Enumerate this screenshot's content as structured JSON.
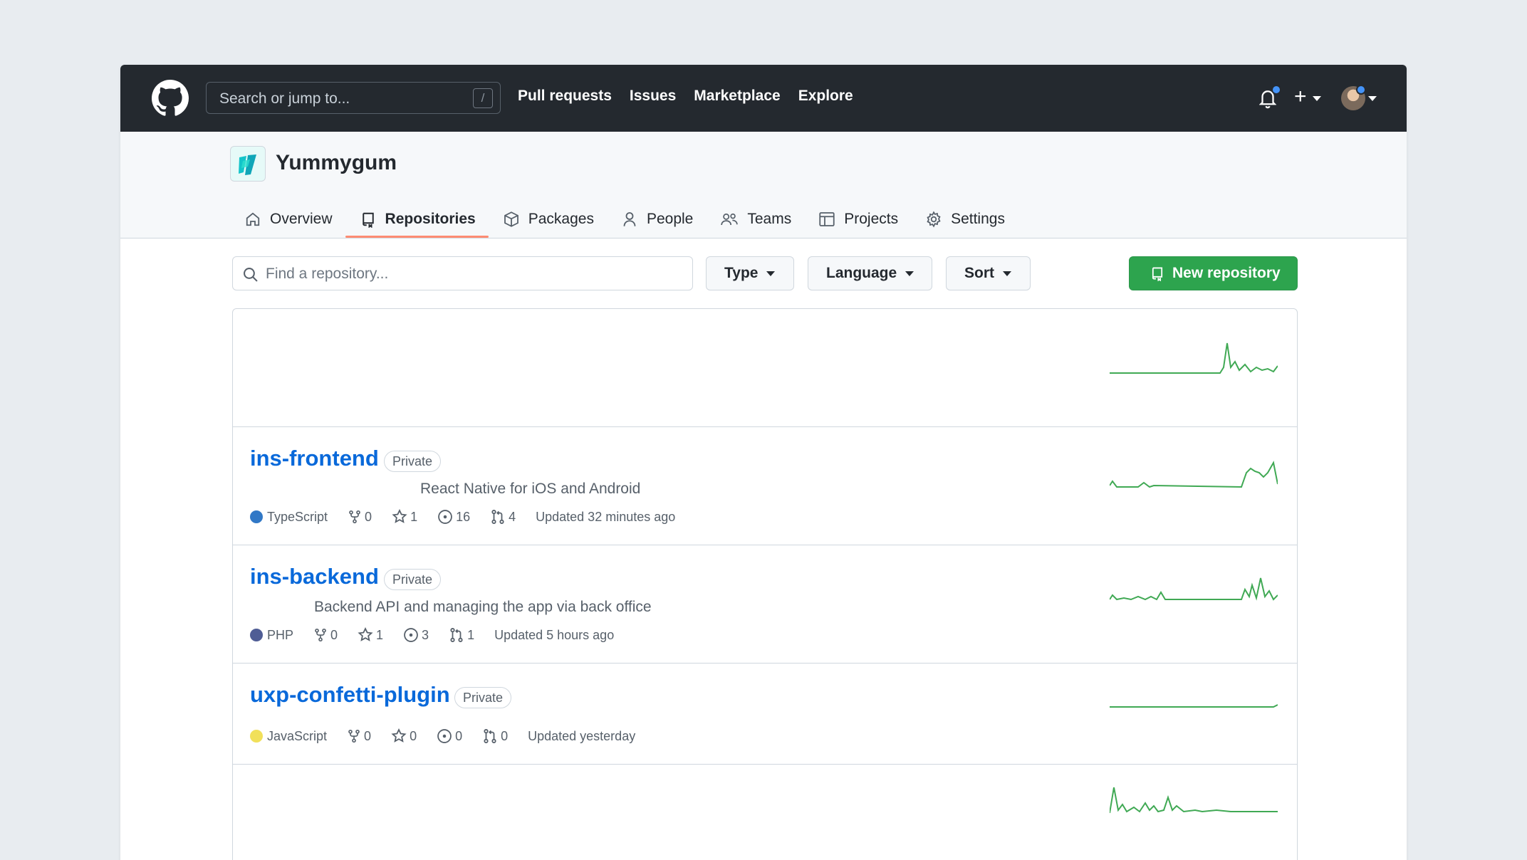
{
  "topbar": {
    "search_placeholder": "Search or jump to...",
    "slash_key": "/",
    "nav": [
      "Pull requests",
      "Issues",
      "Marketplace",
      "Explore"
    ]
  },
  "org": {
    "name": "Yummygum",
    "tabs": [
      {
        "label": "Overview",
        "icon": "home-icon"
      },
      {
        "label": "Repositories",
        "icon": "repo-icon",
        "active": true
      },
      {
        "label": "Packages",
        "icon": "package-icon"
      },
      {
        "label": "People",
        "icon": "person-icon"
      },
      {
        "label": "Teams",
        "icon": "people-icon"
      },
      {
        "label": "Projects",
        "icon": "table-icon"
      },
      {
        "label": "Settings",
        "icon": "gear-icon"
      }
    ]
  },
  "filters": {
    "find_placeholder": "Find a repository...",
    "type": "Type",
    "language": "Language",
    "sort": "Sort",
    "new_repo": "New repository"
  },
  "repos": [
    {
      "name": "ins-frontend",
      "visibility": "Private",
      "description": "React Native for iOS and Android",
      "language": "TypeScript",
      "lang_color": "#3178c6",
      "forks": "0",
      "stars": "1",
      "issues": "16",
      "prs": "4",
      "updated": "Updated 32 minutes ago"
    },
    {
      "name": "ins-backend",
      "visibility": "Private",
      "description": "Backend API and managing the app via back office",
      "language": "PHP",
      "lang_color": "#4F5D95",
      "forks": "0",
      "stars": "1",
      "issues": "3",
      "prs": "1",
      "updated": "Updated 5 hours ago"
    },
    {
      "name": "uxp-confetti-plugin",
      "visibility": "Private",
      "description": "",
      "language": "JavaScript",
      "lang_color": "#f1e05a",
      "forks": "0",
      "stars": "0",
      "issues": "0",
      "prs": "0",
      "updated": "Updated yesterday"
    }
  ],
  "colors": {
    "topbar": "#24292f",
    "accent_tab": "#fd8c73",
    "primary_button": "#2da44e",
    "link": "#0969da",
    "sparkline": "#40a954"
  }
}
